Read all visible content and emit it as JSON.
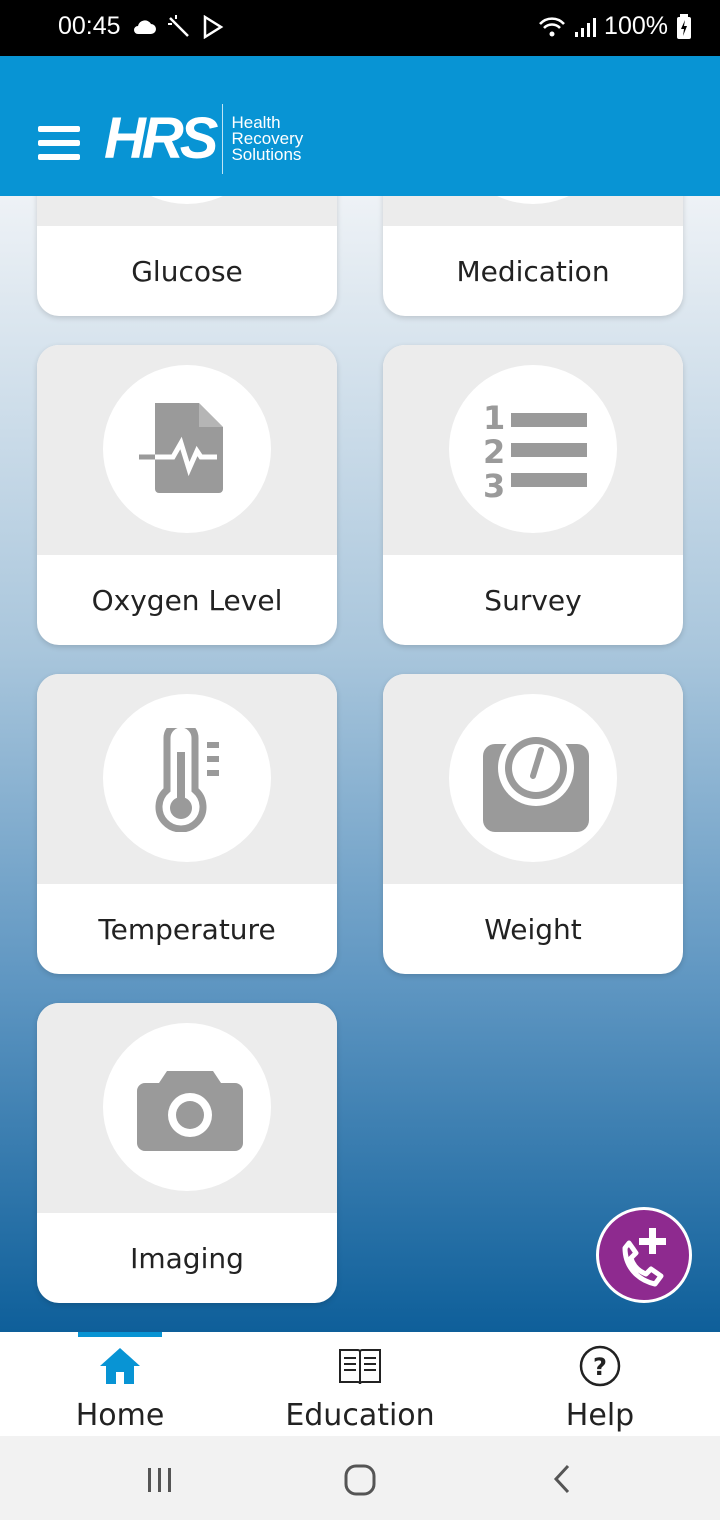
{
  "status_bar": {
    "time": "00:45",
    "battery": "100%"
  },
  "app_bar": {
    "logo_mark": "HRS",
    "logo_line1": "Health",
    "logo_line2": "Recovery",
    "logo_line3": "Solutions"
  },
  "cards": [
    {
      "label": "Glucose",
      "icon": "glucose-icon"
    },
    {
      "label": "Medication",
      "icon": "medication-icon"
    },
    {
      "label": "Oxygen Level",
      "icon": "document-pulse-icon"
    },
    {
      "label": "Survey",
      "icon": "numbered-list-icon"
    },
    {
      "label": "Temperature",
      "icon": "thermometer-icon"
    },
    {
      "label": "Weight",
      "icon": "scale-icon"
    },
    {
      "label": "Imaging",
      "icon": "camera-icon"
    }
  ],
  "bottom_nav": {
    "home": "Home",
    "education": "Education",
    "help": "Help"
  },
  "colors": {
    "primary": "#0894d4",
    "fab": "#8e2a8f",
    "icon_gray": "#9a9a9a"
  }
}
